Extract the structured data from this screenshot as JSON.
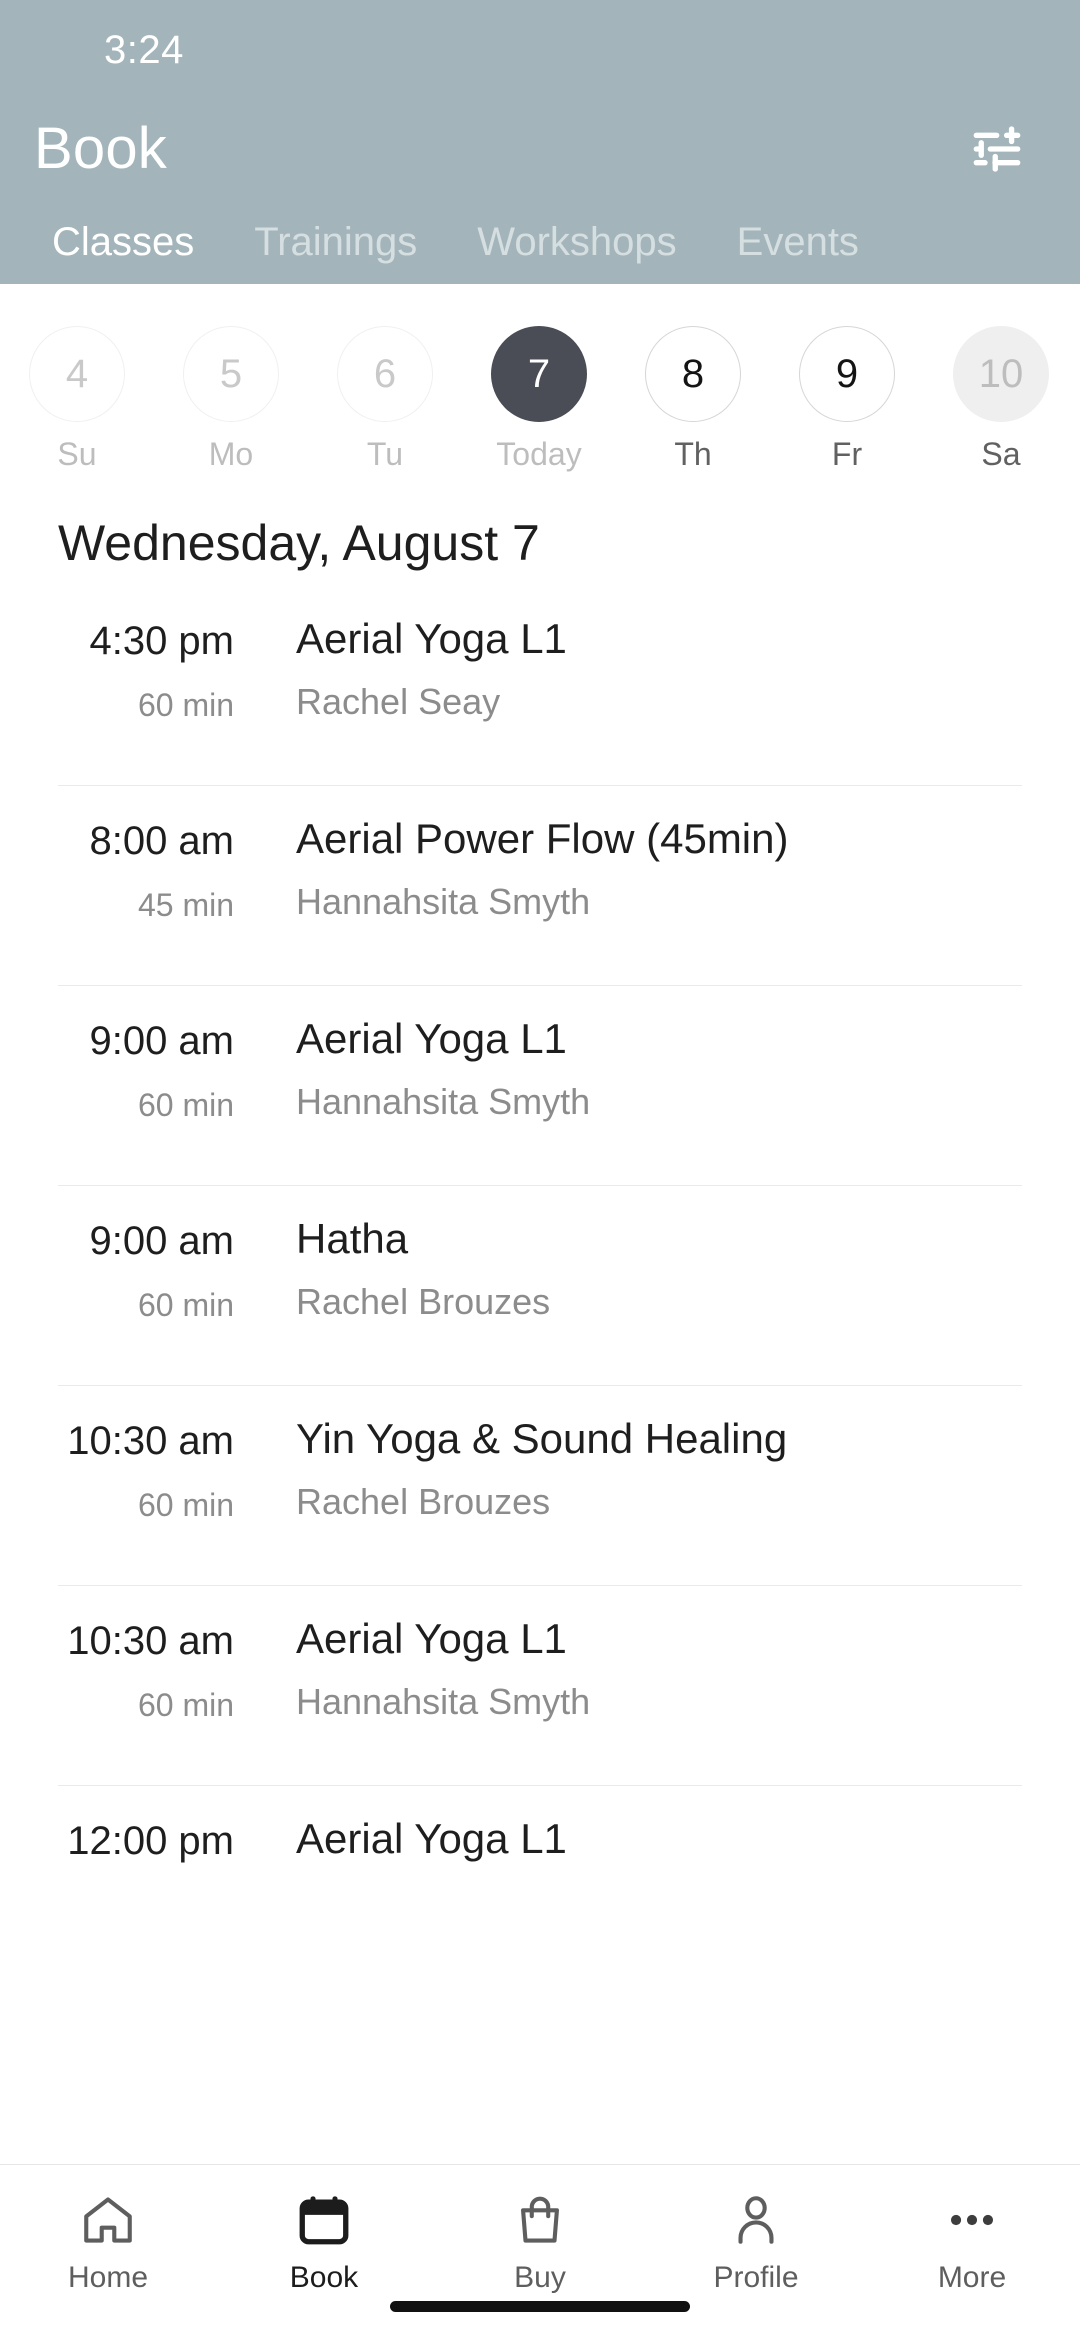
{
  "status_bar": {
    "time": "3:24"
  },
  "header": {
    "title": "Book",
    "filter_icon": "tune-sliders-icon",
    "background_color": "#a3b5ba",
    "tabs": [
      {
        "label": "Classes",
        "active": true
      },
      {
        "label": "Trainings",
        "active": false
      },
      {
        "label": "Workshops",
        "active": false
      },
      {
        "label": "Events",
        "active": false
      }
    ]
  },
  "date_strip": {
    "days": [
      {
        "num": "4",
        "label": "Su",
        "state": "past"
      },
      {
        "num": "5",
        "label": "Mo",
        "state": "past"
      },
      {
        "num": "6",
        "label": "Tu",
        "state": "past"
      },
      {
        "num": "7",
        "label": "Today",
        "state": "today"
      },
      {
        "num": "8",
        "label": "Th",
        "state": "future"
      },
      {
        "num": "9",
        "label": "Fr",
        "state": "future"
      },
      {
        "num": "10",
        "label": "Sa",
        "state": "disabled"
      }
    ],
    "selected_color": "#4a4d55"
  },
  "schedule": {
    "day_heading": "Wednesday, August 7",
    "rows": [
      {
        "time": "4:30 pm",
        "duration": "60 min",
        "name": "Aerial Yoga L1",
        "teacher": "Rachel Seay"
      },
      {
        "time": "8:00 am",
        "duration": "45 min",
        "name": "Aerial Power Flow (45min)",
        "teacher": "Hannahsita Smyth"
      },
      {
        "time": "9:00 am",
        "duration": "60 min",
        "name": "Aerial Yoga L1",
        "teacher": "Hannahsita Smyth"
      },
      {
        "time": "9:00 am",
        "duration": "60 min",
        "name": "Hatha",
        "teacher": "Rachel Brouzes"
      },
      {
        "time": "10:30 am",
        "duration": "60 min",
        "name": "Yin Yoga & Sound Healing",
        "teacher": "Rachel Brouzes"
      },
      {
        "time": "10:30 am",
        "duration": "60 min",
        "name": "Aerial Yoga L1",
        "teacher": "Hannahsita Smyth"
      },
      {
        "time": "12:00 pm",
        "duration": "",
        "name": "Aerial Yoga L1",
        "teacher": ""
      }
    ]
  },
  "bottom_nav": {
    "items": [
      {
        "label": "Home",
        "icon": "house-icon",
        "active": false
      },
      {
        "label": "Book",
        "icon": "calendar-icon",
        "active": true
      },
      {
        "label": "Buy",
        "icon": "shopping-bag-icon",
        "active": false
      },
      {
        "label": "Profile",
        "icon": "person-icon",
        "active": false
      },
      {
        "label": "More",
        "icon": "ellipsis-icon",
        "active": false
      }
    ]
  }
}
